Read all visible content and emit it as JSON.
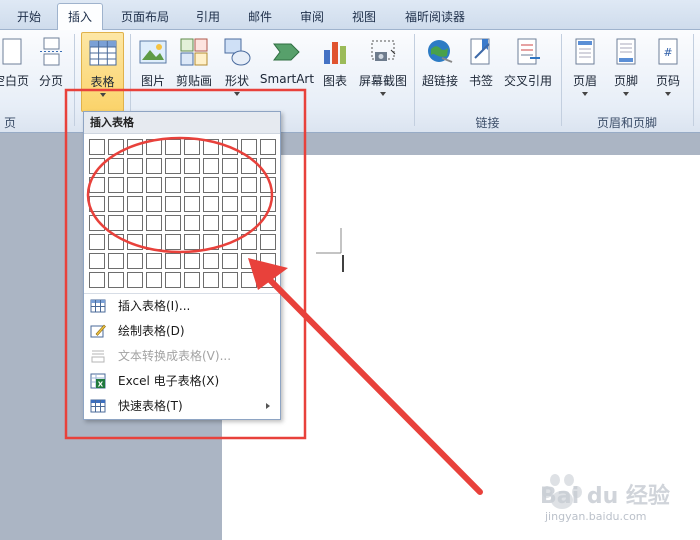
{
  "tabs": [
    {
      "label": "开始"
    },
    {
      "label": "插入",
      "active": true
    },
    {
      "label": "页面布局"
    },
    {
      "label": "引用"
    },
    {
      "label": "邮件"
    },
    {
      "label": "审阅"
    },
    {
      "label": "视图"
    },
    {
      "label": "福昕阅读器"
    }
  ],
  "ribbon": {
    "buttons": {
      "blank_page": "空白页",
      "page_break": "分页",
      "table": "表格",
      "picture": "图片",
      "clipart": "剪贴画",
      "shapes": "形状",
      "smartart": "SmartArt",
      "chart": "图表",
      "screenshot": "屏幕截图",
      "hyperlink": "超链接",
      "bookmark": "书签",
      "cross_ref": "交叉引用",
      "header": "页眉",
      "footer": "页脚",
      "page_number": "页码"
    },
    "groups": {
      "pages": "页",
      "links": "链接",
      "header_footer": "页眉和页脚"
    }
  },
  "dropdown": {
    "title": "插入表格",
    "grid": {
      "cols": 10,
      "rows": 8
    },
    "items": [
      {
        "label": "插入表格(I)...",
        "icon": "table-icon",
        "disabled": false
      },
      {
        "label": "绘制表格(D)",
        "icon": "draw-table-icon",
        "disabled": false
      },
      {
        "label": "文本转换成表格(V)...",
        "icon": "text-to-table-icon",
        "disabled": true
      },
      {
        "label": "Excel 电子表格(X)",
        "icon": "excel-icon",
        "disabled": false
      },
      {
        "label": "快速表格(T)",
        "icon": "quick-table-icon",
        "disabled": false,
        "submenu": true
      }
    ]
  },
  "watermark": {
    "text": "Bai du 经验",
    "sub": "jingyan.baidu.com"
  },
  "colors": {
    "annotation": "#e8413b",
    "accent": "#fbd36a"
  }
}
